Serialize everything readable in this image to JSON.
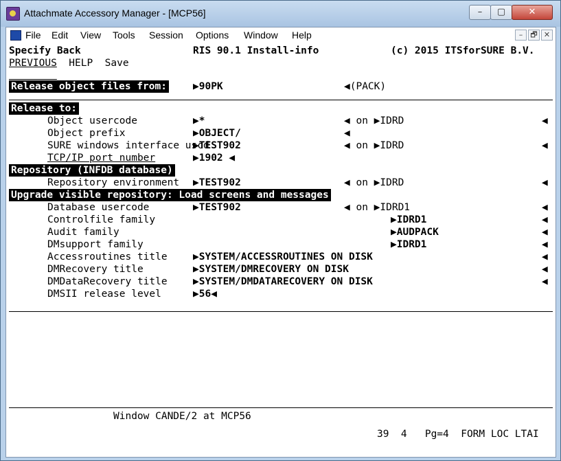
{
  "window": {
    "title": "Attachmate Accessory Manager - [MCP56]",
    "minimize": "–",
    "maximize": "▢",
    "close": "✕"
  },
  "menu": [
    "File",
    "Edit",
    "View",
    "Tools",
    "Session",
    "Options",
    "Window",
    "Help"
  ],
  "mdi": [
    "–",
    "🗗",
    "✕"
  ],
  "header": {
    "left": "Specify Back",
    "center": "RIS 90.1 Install-info",
    "right": "(c) 2015 ITSforSURE B.V."
  },
  "actions": "PREVIOUS  HELP  Save",
  "release_from": {
    "label": "Release object files from:",
    "value": "▶90PK",
    "pack": "◀(PACK)"
  },
  "release_to": {
    "heading": "Release to:",
    "rows": [
      {
        "label": "Object usercode",
        "value": "▶*",
        "on": "◀ on ▶IDRD",
        "end": "◀"
      },
      {
        "label": "Object prefix",
        "value": "▶OBJECT/",
        "on": "◀",
        "end": ""
      },
      {
        "label": "SURE windows interface uscd",
        "value": "▶TEST902",
        "on": "◀ on ▶IDRD",
        "end": "◀"
      },
      {
        "label": "TCP/IP port number",
        "value": "▶1902 ◀",
        "on": "",
        "end": ""
      }
    ]
  },
  "repository": {
    "heading": "Repository (INFDB database)",
    "label": "Repository environment",
    "value": "▶TEST902",
    "on": "◀ on ▶IDRD",
    "end": "◀"
  },
  "upgrade": {
    "heading": "Upgrade visible repository: Load screens and messages",
    "rows": [
      {
        "label": "Database usercode",
        "value": "▶TEST902",
        "on": "◀ on ▶IDRD1",
        "end": "◀"
      },
      {
        "label": "Controlfile family",
        "value": "",
        "on": "▶IDRD1",
        "end": "◀"
      },
      {
        "label": "Audit family",
        "value": "",
        "on": "▶AUDPACK",
        "end": "◀"
      },
      {
        "label": "DMsupport family",
        "value": "",
        "on": "▶IDRD1",
        "end": "◀"
      },
      {
        "label": "Accessroutines title",
        "value": "▶SYSTEM/ACCESSROUTINES ON DISK",
        "on": "",
        "end": "◀"
      },
      {
        "label": "DMRecovery title",
        "value": "▶SYSTEM/DMRECOVERY ON DISK",
        "on": "",
        "end": "◀"
      },
      {
        "label": "DMDataRecovery title",
        "value": "▶SYSTEM/DMDATARECOVERY ON DISK",
        "on": "",
        "end": "◀"
      },
      {
        "label": "DMSII release level",
        "value": "▶56◀",
        "on": "",
        "end": ""
      }
    ]
  },
  "status": {
    "window_line": "Window CANDE/2 at MCP56",
    "indicators": "39  4   Pg=4  FORM LOC LTAI"
  }
}
